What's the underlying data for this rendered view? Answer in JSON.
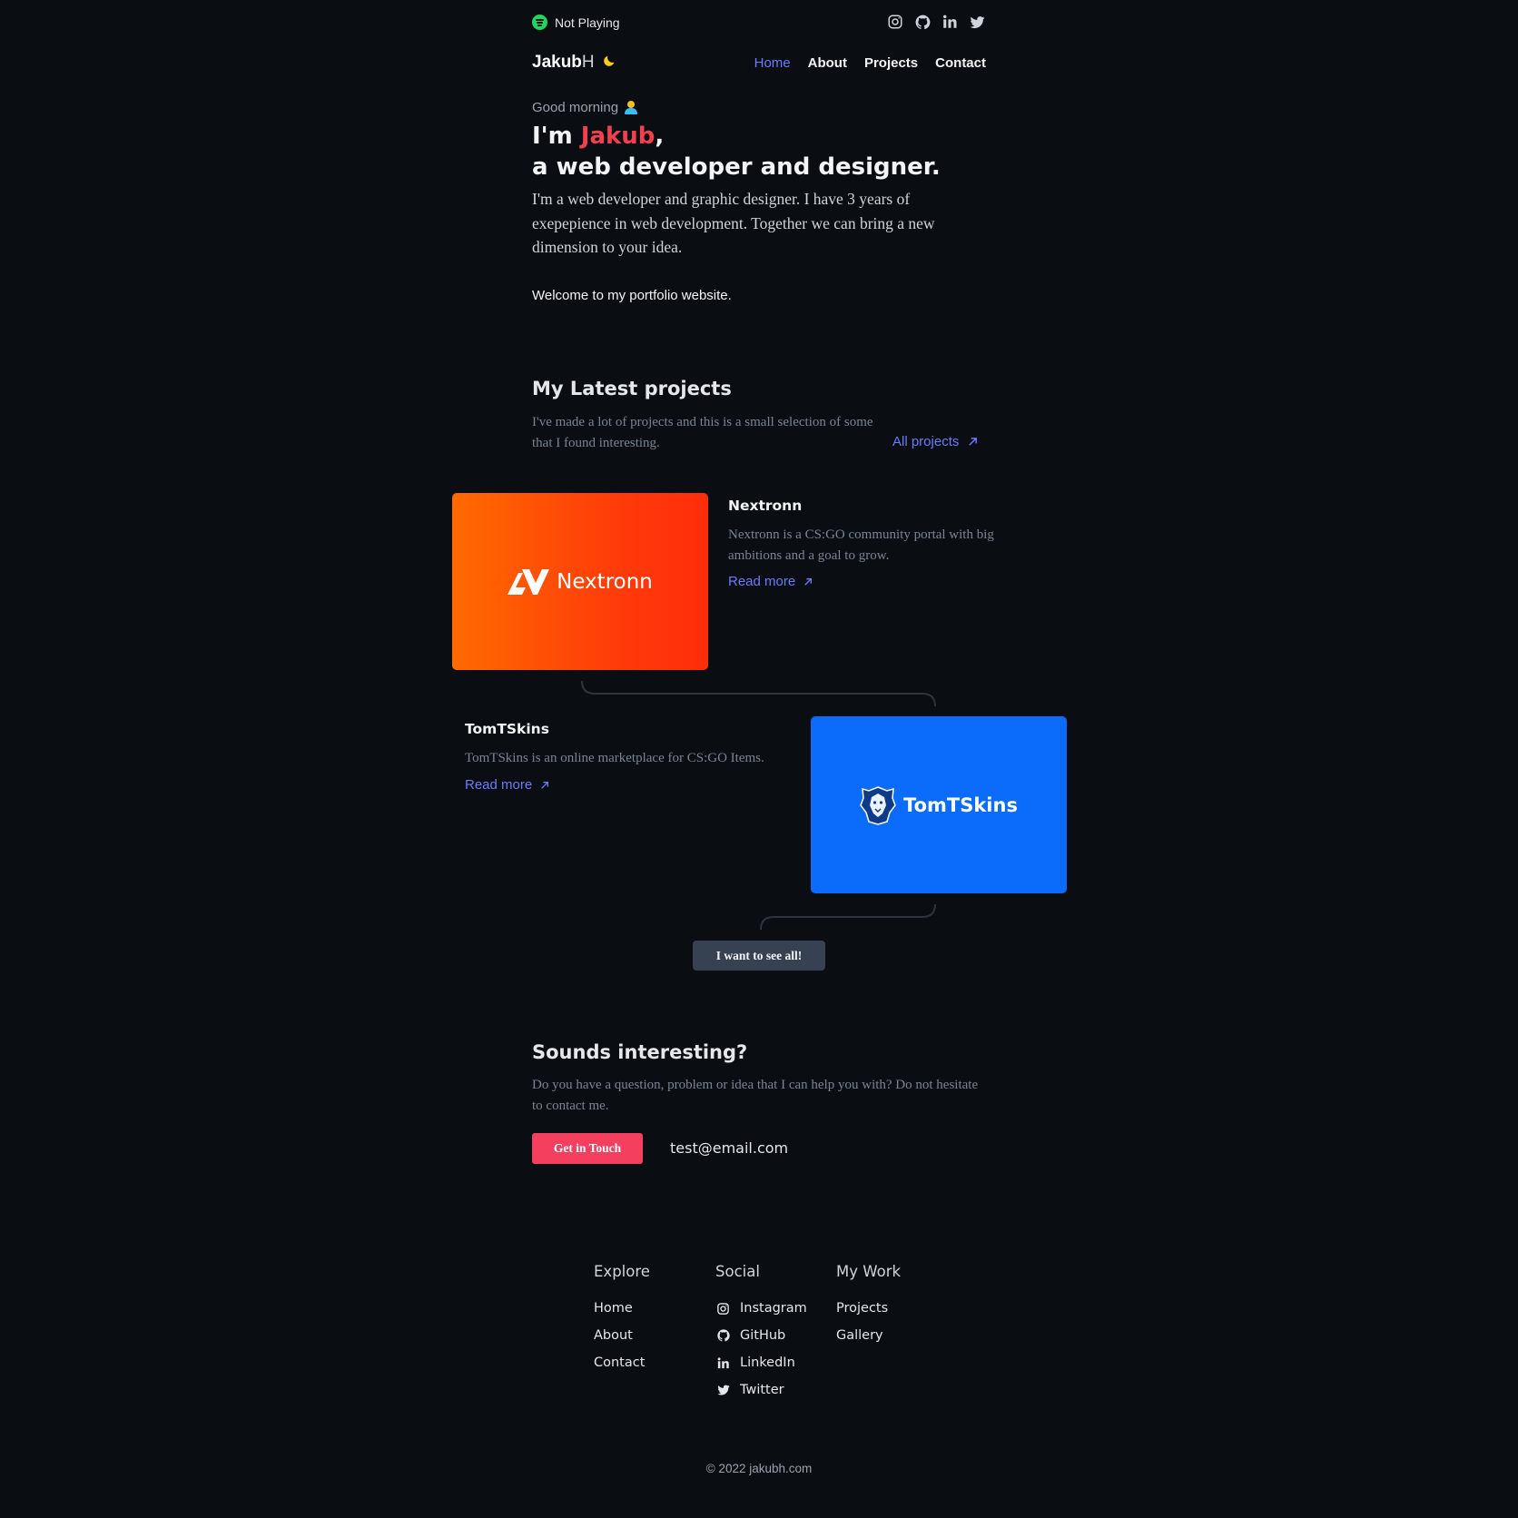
{
  "spotify": {
    "status": "Not Playing",
    "icon": "spotify-icon",
    "color": "#1ed760"
  },
  "social_icons": [
    "instagram-icon",
    "github-icon",
    "linkedin-icon",
    "twitter-icon"
  ],
  "nav": {
    "logo_bold": "Jakub",
    "logo_light": "H",
    "theme_icon": "moon-icon",
    "links": [
      "Home",
      "About",
      "Projects",
      "Contact"
    ],
    "active": "Home"
  },
  "hero": {
    "greeting": "Good morning",
    "heading_prefix": "I'm ",
    "heading_name": "Jakub",
    "heading_comma": ",",
    "heading_line2": "a web developer and designer.",
    "intro": "I'm a web developer and graphic designer. I have 3 years of exepерience in web development. Together we can bring a new dimension to your idea.",
    "welcome": "Welcome to my portfolio website."
  },
  "projects_section": {
    "title": "My Latest projects",
    "description": "I've made a lot of projects and this is a small selection of some that I found interesting.",
    "all_projects_label": "All projects",
    "projects": [
      {
        "title": "Nextronn",
        "description": "Nextronn is a CS:GO community portal with big ambitions and a goal to grow.",
        "read_more": "Read more",
        "brand": "Nextronn"
      },
      {
        "title": "TomTSkins",
        "description": "TomTSkins is an online marketplace for CS:GO Items.",
        "read_more": "Read more",
        "brand": "TomTSkins"
      }
    ],
    "see_all_label": "I want to see all!"
  },
  "contact": {
    "title": "Sounds interesting?",
    "description": "Do you have a question, problem or idea that I can help you with? Do not hesitate to contact me.",
    "button_label": "Get in Touch",
    "email": "test@email.com"
  },
  "footer": {
    "explore": {
      "heading": "Explore",
      "links": [
        "Home",
        "About",
        "Contact"
      ]
    },
    "social": {
      "heading": "Social",
      "links": [
        "Instagram",
        "GitHub",
        "LinkedIn",
        "Twitter"
      ]
    },
    "work": {
      "heading": "My Work",
      "links": [
        "Projects",
        "Gallery"
      ]
    },
    "copyright": "© 2022 jakubh.com"
  },
  "colors": {
    "background": "#0a0d11",
    "accent": "#6b7cff",
    "name_red": "#f43f4f",
    "cta": "#f43f5e",
    "nextronn_orange": "#ff5a00",
    "tomtskins_blue": "#0b6bfa"
  }
}
